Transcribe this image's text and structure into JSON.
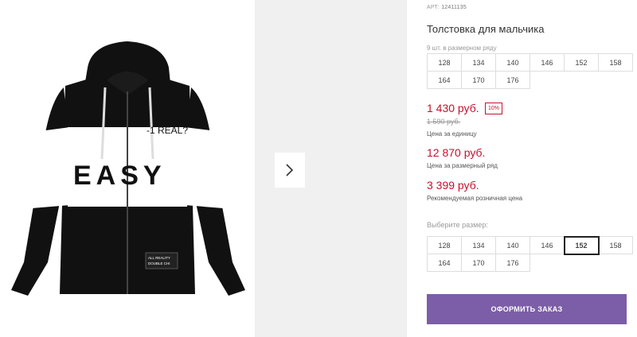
{
  "product": {
    "sku_label": "АРТ:",
    "sku_value": "12411135",
    "title": "Толстовка для мальчика",
    "size_note": "9 шт. в размерном ряду"
  },
  "size_row_sizes": [
    "128",
    "134",
    "140",
    "146",
    "152",
    "158",
    "164",
    "170",
    "176"
  ],
  "prices": {
    "unit_price": "1 430 руб.",
    "discount": "10%",
    "old_price": "1 590 руб.",
    "unit_label": "Цена за единицу",
    "range_price": "12 870 руб.",
    "range_label": "Цена за размерный ряд",
    "retail_price": "3 399 руб.",
    "retail_label": "Рекомендуемая розничная цена"
  },
  "size_select": {
    "label": "Выберите размер:",
    "sizes": [
      "128",
      "134",
      "140",
      "146",
      "152",
      "158",
      "164",
      "170",
      "176"
    ],
    "selected": "152"
  },
  "order_button": "ОФОРМИТЬ ЗАКАЗ",
  "colors": {
    "price_red": "#c8102e",
    "button_purple": "#7b5ea7"
  },
  "gallery": {
    "next_icon": "chevron-right-icon",
    "hoodie_print": {
      "slogan": "-1 REAL?",
      "word": "EASY",
      "patch_line1": "ALL REALITY",
      "patch_line2": "DOUBLE CHI"
    }
  }
}
